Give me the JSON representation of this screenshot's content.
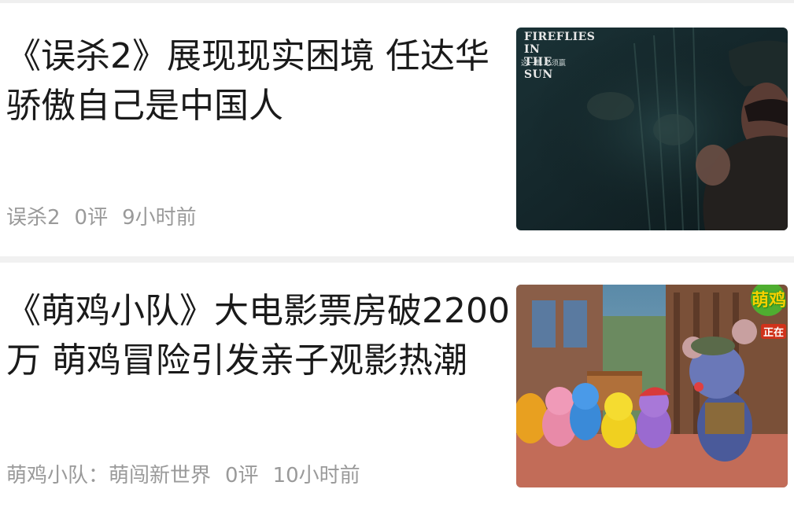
{
  "feed": {
    "items": [
      {
        "title": "《误杀2》展现现实困境 任达华骄傲自己是中国人",
        "source": "误杀2",
        "comments": "0评",
        "time": "9小时前",
        "thumbnail": {
          "poster_title": "FIREFLIES IN THE SUN",
          "poster_sub": "这一局 必须赢"
        }
      },
      {
        "title": "《萌鸡小队》大电影票房破2200万 萌鸡冒险引发亲子观影热潮",
        "source": "萌鸡小队：萌闯新世界",
        "comments": "0评",
        "time": "10小时前",
        "thumbnail": {
          "logo_text": "萌鸡",
          "logo_sub": "正在"
        }
      }
    ]
  },
  "colors": {
    "title": "#1a1a1a",
    "meta": "#9a9a9a",
    "divider": "#f1f1f1"
  }
}
